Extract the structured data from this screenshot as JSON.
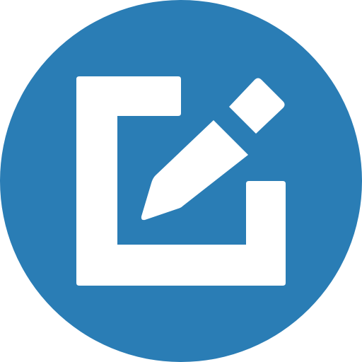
{
  "icon": {
    "name": "edit-icon",
    "background_color": "#2A7DB5",
    "foreground_color": "#FFFFFF"
  }
}
